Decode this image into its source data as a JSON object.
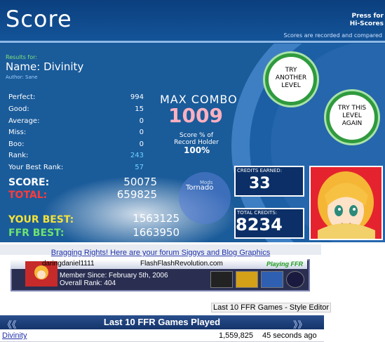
{
  "header": {
    "title": "Score",
    "press_hi_line1": "Press for",
    "press_hi_line2": "Hi-Scores",
    "scores_note": "Scores are recorded and compared"
  },
  "song": {
    "results_for": "Results for:",
    "name": "Name: Divinity",
    "author": "Author: Sane"
  },
  "stats": [
    {
      "label": "Perfect:",
      "value": "994"
    },
    {
      "label": "Good:",
      "value": "15"
    },
    {
      "label": "Average:",
      "value": "0"
    },
    {
      "label": "Miss:",
      "value": "0"
    },
    {
      "label": "Boo:",
      "value": "0"
    },
    {
      "label": "Rank:",
      "value": "243"
    },
    {
      "label": "Your Best Rank:",
      "value": "57"
    }
  ],
  "combo": {
    "label": "MAX COMBO",
    "value": "1009",
    "pct_label_line1": "Score % of",
    "pct_label_line2": "Record Holder",
    "pct_value": "100%"
  },
  "buttons": {
    "try_another": [
      "TRY",
      "ANOTHER",
      "LEVEL"
    ],
    "try_again": [
      "TRY THIS",
      "LEVEL",
      "AGAIN"
    ]
  },
  "scores": {
    "score_label": "SCORE:",
    "score_value": "50075",
    "total_label": "TOTAL:",
    "total_value": "659825",
    "best_label": "YOUR BEST:",
    "best_value": "1563125",
    "ffr_label": "FFR BEST:",
    "ffr_value": "1663950"
  },
  "mods": {
    "label": "Mods",
    "value": "Tornado"
  },
  "credits": {
    "earned_label": "CREDITS EARNED:",
    "earned_value": "33",
    "total_label": "TOTAL CREDITS:",
    "total_value": "8234"
  },
  "bottom": {
    "bragging": "Bragging Rights! Here are your forum Siggys and Blog Graphics",
    "sig_user": "daringdaniel1111",
    "sig_site": "FlashFlashRevolution.com",
    "sig_playing": "Playing FFR",
    "sig_member": "Member Since: February 5th, 2006",
    "sig_rank": "Overall Rank: 404",
    "style_editor": "Last 10 FFR Games - Style Editor",
    "last10_title": "Last 10 FFR Games Played",
    "games": [
      {
        "song": "Divinity",
        "score": "1,559,825",
        "time": "45 seconds ago"
      }
    ]
  },
  "colors": {
    "background": "#1a5b9a",
    "total_red": "#ff3a3a",
    "best_yellow": "#f3e23a",
    "ffr_green": "#6fe36f",
    "combo_pink": "#ffb0c0",
    "button_green": "#2f9a3e"
  }
}
